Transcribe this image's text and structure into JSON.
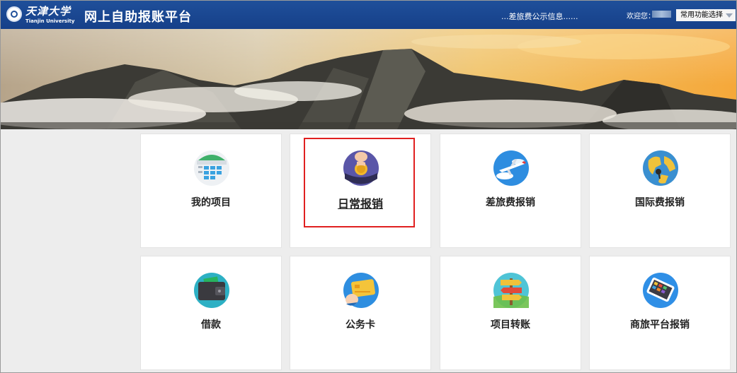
{
  "header": {
    "logo_cn": "天津大学",
    "logo_en": "Tianjin University",
    "app_title": "网上自助报账平台",
    "notice_text": "...差旅费公示信息......",
    "welcome_text": "欢迎您：",
    "quick_select": "常用功能选择",
    "brand_color": "#164089"
  },
  "tiles": [
    {
      "label": "我的项目",
      "icon": "project-calendar-icon"
    },
    {
      "label": "日常报销",
      "icon": "coin-hand-icon",
      "active": true
    },
    {
      "label": "差旅费报销",
      "icon": "airplane-icon"
    },
    {
      "label": "国际费报销",
      "icon": "globe-icon"
    },
    {
      "label": "借款",
      "icon": "wallet-icon"
    },
    {
      "label": "公务卡",
      "icon": "credit-card-icon"
    },
    {
      "label": "项目转账",
      "icon": "signpost-icon"
    },
    {
      "label": "商旅平台报销",
      "icon": "tablet-icon"
    }
  ],
  "highlight_color": "#e02020"
}
